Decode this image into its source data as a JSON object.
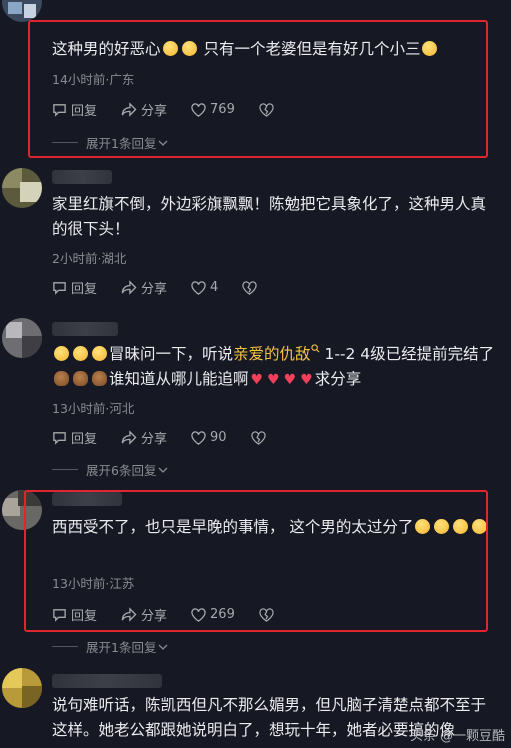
{
  "comments": [
    {
      "text_parts": [
        "这种男的好恶心",
        "",
        "",
        "只有一个老婆但是有好几个小三",
        ""
      ],
      "meta": "14小时前·广东",
      "reply_label": "回复",
      "share_label": "分享",
      "likes": "769",
      "expand_label": "展开1条回复"
    },
    {
      "text": "家里红旗不倒，外边彩旗飘飘！陈勉把它具象化了，这种男人真的很下头！",
      "meta": "2小时前·湖北",
      "reply_label": "回复",
      "share_label": "分享",
      "likes": "4"
    },
    {
      "text_a": "冒昧问一下，听说",
      "link": "亲爱的仇敌",
      "text_b": " 1--2 4级已经提前完结了",
      "text_c": "谁知道从哪儿能追啊",
      "text_d": "求分享",
      "meta": "13小时前·河北",
      "reply_label": "回复",
      "share_label": "分享",
      "likes": "90",
      "expand_label": "展开6条回复"
    },
    {
      "text": "西西受不了，也只是早晚的事情， 这个男的太过分了",
      "meta": "13小时前·江苏",
      "reply_label": "回复",
      "share_label": "分享",
      "likes": "269",
      "expand_label": "展开1条回复"
    },
    {
      "text": "说句难听话，陈凯西但凡不那么媚男，但凡脑子清楚点都不至于这样。她老公都跟她说明白了，想玩十年，她者必要搞的像"
    }
  ],
  "watermark": "头条 @一颗豆酷",
  "colors": {
    "background": "#161823",
    "highlight_box": "#e0262d",
    "link": "#f5c242",
    "heart": "#f2405b"
  }
}
